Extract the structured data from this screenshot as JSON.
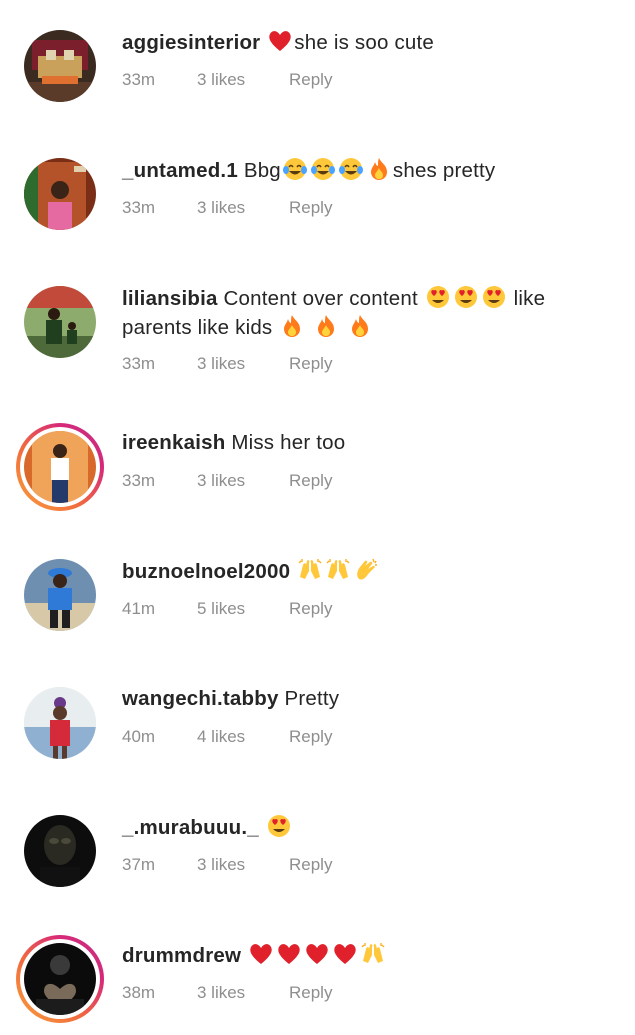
{
  "comments": [
    {
      "username": "aggiesinterior",
      "text_before": "",
      "emojis_before": [
        "red-heart"
      ],
      "text": "she is soo cute",
      "emojis_after": [],
      "time": "33m",
      "likes": "3 likes",
      "reply": "Reply",
      "story_ring": false,
      "avatar_colors": [
        "#3a2a20",
        "#c9a15a",
        "#7a1f2b",
        "#e0d3b0"
      ]
    },
    {
      "username": "_untamed.1",
      "text": "Bbg",
      "emojis_mid": [
        "tears-of-joy",
        "tears-of-joy",
        "tears-of-joy",
        "fire"
      ],
      "text_after": "shes pretty",
      "time": "33m",
      "likes": "3 likes",
      "reply": "Reply",
      "story_ring": false,
      "avatar_colors": [
        "#7a2e16",
        "#b4532a",
        "#e56aa1",
        "#2e6b2e"
      ]
    },
    {
      "username": "liliansibia",
      "text": "Content over content",
      "emojis_mid": [
        "heart-eyes",
        "heart-eyes",
        "heart-eyes"
      ],
      "text_after": "like parents like kids",
      "emojis_after": [
        "fire",
        "fire",
        "fire"
      ],
      "time": "33m",
      "likes": "3 likes",
      "reply": "Reply",
      "story_ring": false,
      "avatar_colors": [
        "#4f6a3a",
        "#1f3f1f",
        "#c14a3a",
        "#8cab6d"
      ]
    },
    {
      "username": "ireenkaish",
      "text": "Miss her too",
      "time": "33m",
      "likes": "3 likes",
      "reply": "Reply",
      "story_ring": true,
      "avatar_colors": [
        "#d9692a",
        "#f0a45a",
        "#ffffff",
        "#243a6b"
      ]
    },
    {
      "username": "buznoelnoel2000",
      "emojis_after": [
        "raising-hands",
        "raising-hands",
        "clapping-hands"
      ],
      "time": "41m",
      "likes": "5 likes",
      "reply": "Reply",
      "story_ring": false,
      "avatar_colors": [
        "#6e8fb0",
        "#2f7ad6",
        "#1f1f1f",
        "#d7c9a8"
      ]
    },
    {
      "username": "wangechi.tabby",
      "text": "Pretty",
      "time": "40m",
      "likes": "4 likes",
      "reply": "Reply",
      "story_ring": false,
      "avatar_colors": [
        "#e8eef0",
        "#d42a3a",
        "#5a3b2b",
        "#8fb0d0"
      ]
    },
    {
      "username": "_.murabuuu._",
      "emojis_after": [
        "heart-eyes"
      ],
      "time": "37m",
      "likes": "3 likes",
      "reply": "Reply",
      "story_ring": false,
      "avatar_colors": [
        "#0d0d0d",
        "#2a2a22",
        "#4a4a3a",
        "#111111"
      ]
    },
    {
      "username": "drummdrew",
      "emojis_after": [
        "red-heart",
        "red-heart",
        "red-heart",
        "red-heart",
        "raising-hands"
      ],
      "time": "38m",
      "likes": "3 likes",
      "reply": "Reply",
      "story_ring": true,
      "avatar_colors": [
        "#0b0b0b",
        "#3a3a3a",
        "#7a6a5a",
        "#1c1c1c"
      ]
    }
  ],
  "colors": {
    "text_primary": "#262626",
    "text_secondary": "#8e8e8e",
    "story_ring_gradient": [
      "#f9a13b",
      "#d6287a"
    ],
    "background": "#ffffff"
  }
}
